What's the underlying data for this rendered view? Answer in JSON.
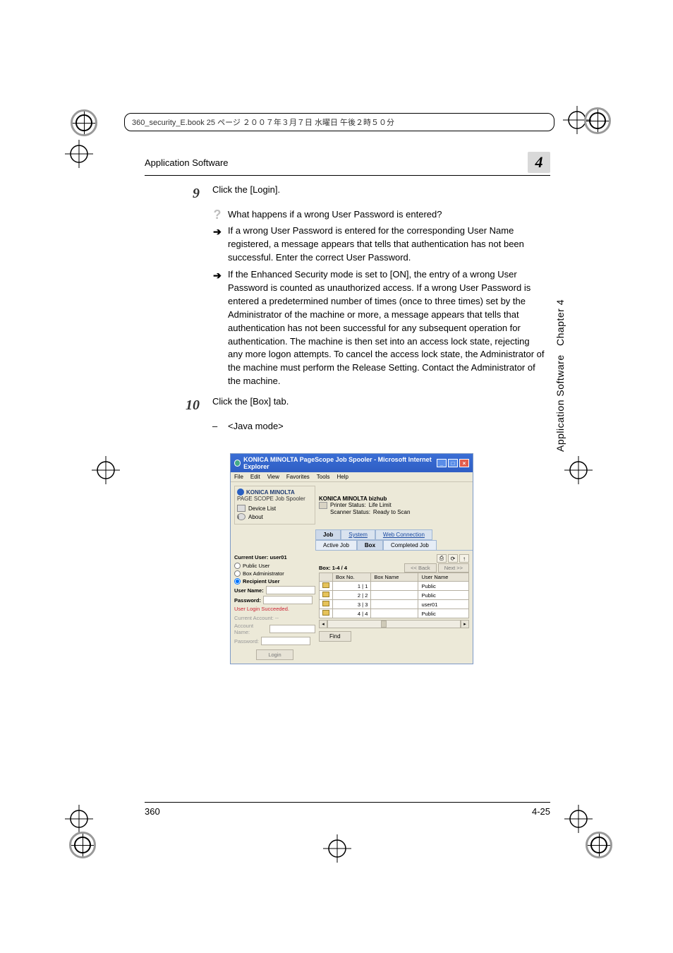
{
  "header_file_info": "360_security_E.book  25 ページ  ２００７年３月７日 水曜日 午後２時５０分",
  "running_header": "Application Software",
  "chapter_tab": "4",
  "side_chapter": "Chapter 4",
  "side_section": "Application Software",
  "steps": {
    "s9": {
      "num": "9",
      "text": "Click the [Login].",
      "q": "What happens if a wrong User Password is entered?",
      "a1": "If a wrong User Password is entered for the corresponding User Name registered, a message appears that tells that authentication has not been successful. Enter the correct User Password.",
      "a2": "If the Enhanced Security mode is set to [ON], the entry of a wrong User Password is counted as unauthorized access. If a wrong User Password is entered a predetermined number of times (once to three times) set by the Administrator of the machine or more, a message appears that tells that authentication has not been successful for any subsequent operation for authentication. The machine is then set into an access lock state, rejecting any more logon attempts. To cancel the access lock state, the Administrator of the machine must perform the Release Setting. Contact the Administrator of the machine."
    },
    "s10": {
      "num": "10",
      "text": "Click the [Box] tab.",
      "sub": "<Java mode>"
    }
  },
  "screenshot": {
    "window_title": "KONICA MINOLTA PageScope Job Spooler - Microsoft Internet Explorer",
    "menubar": [
      "File",
      "Edit",
      "View",
      "Favorites",
      "Tools",
      "Help"
    ],
    "brand_line1": "KONICA MINOLTA",
    "brand_line2": "PAGE SCOPE Job Spooler",
    "device_list": "Device List",
    "about": "About",
    "device_name": "KONICA MINOLTA bizhub",
    "printer_status_label": "Printer Status:",
    "printer_status_value": "Life Limit",
    "scanner_status_label": "Scanner Status:",
    "scanner_status_value": "Ready to Scan",
    "tabs": {
      "job": "Job",
      "system": "System",
      "web": "Web Connection"
    },
    "subtabs": {
      "active": "Active Job",
      "box": "Box",
      "completed": "Completed Job"
    },
    "left": {
      "current_user_label": "Current User:",
      "current_user_value": "user01",
      "public_user": "Public User",
      "box_admin": "Box Administrator",
      "recipient_user": "Recipient User",
      "user_name_label": "User Name:",
      "password_label": "Password:",
      "login_success": "User Login Succeeded.",
      "current_account_label": "Current Account:",
      "current_account_value": "--",
      "account_name_label": "Account Name:",
      "account_password_label": "Password:",
      "login_btn": "Login"
    },
    "right": {
      "range": "Box: 1-4 / 4",
      "back": "<< Back",
      "next": "Next >>",
      "cols": [
        "",
        "Box No.",
        "Box Name",
        "User Name"
      ],
      "rows": [
        {
          "no": "1",
          "idx": "1",
          "name": "",
          "user": "Public"
        },
        {
          "no": "2",
          "idx": "2",
          "name": "",
          "user": "Public"
        },
        {
          "no": "3",
          "idx": "3",
          "name": "",
          "user": "user01"
        },
        {
          "no": "4",
          "idx": "4",
          "name": "",
          "user": "Public"
        }
      ],
      "find": "Find"
    }
  },
  "footer": {
    "left": "360",
    "right": "4-25"
  }
}
